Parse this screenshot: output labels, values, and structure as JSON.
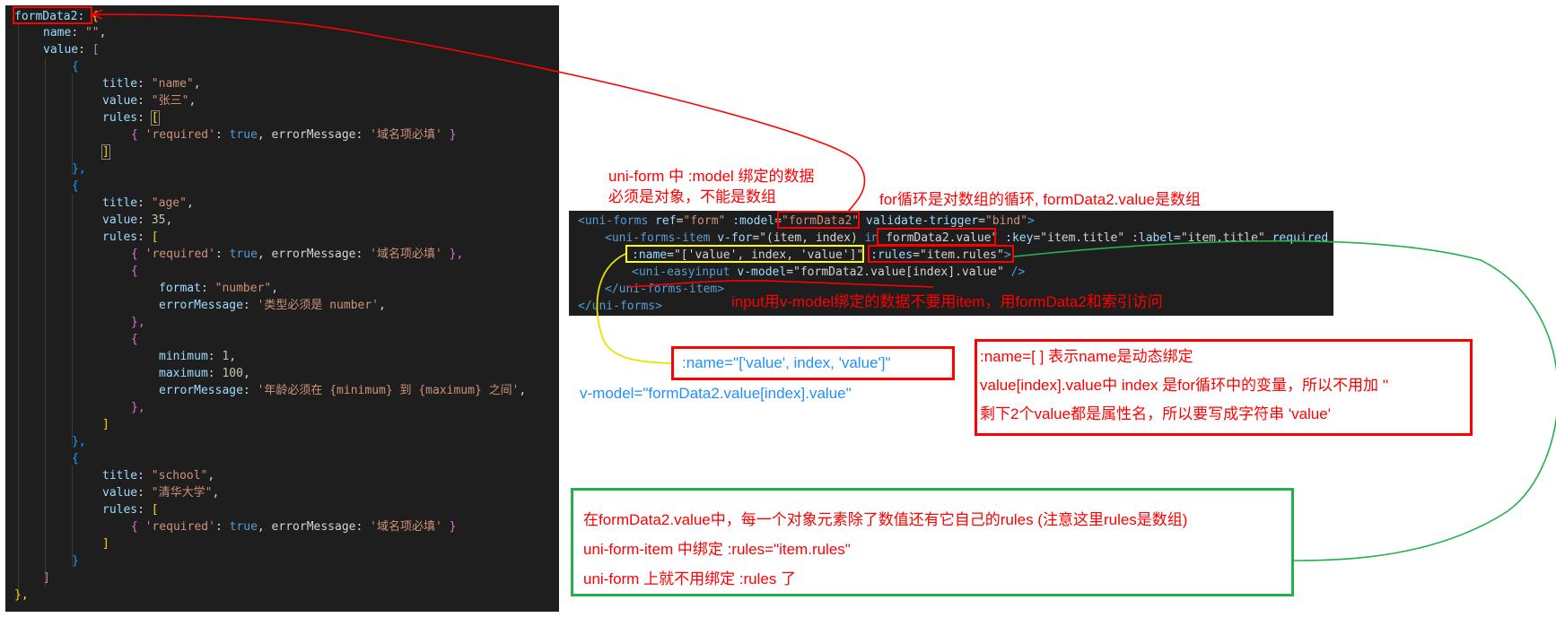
{
  "left_code": {
    "l1": "formData2:",
    "l1b": " {",
    "l2a": "name",
    "l2b": ": ",
    "l2c": "\"\"",
    "l2d": ",",
    "l3a": "value",
    "l3b": ": ",
    "l3c": "[",
    "l4": "{",
    "l5a": "title",
    "l5b": ": ",
    "l5c": "\"name\"",
    "l5d": ",",
    "l6a": "value",
    "l6b": ": ",
    "l6c": "\"张三\"",
    "l6d": ",",
    "l7a": "rules",
    "l7b": ": ",
    "l7c": "[",
    "l8a": "{ ",
    "l8b": "'required'",
    "l8c": ": ",
    "l8d": "true",
    "l8e": ", errorMessage: ",
    "l8f": "'域名项必填'",
    "l8g": " }",
    "l9": "]",
    "l10": "},",
    "l11": "{",
    "l12a": "title",
    "l12b": ": ",
    "l12c": "\"age\"",
    "l12d": ",",
    "l13a": "value",
    "l13b": ": ",
    "l13c": "35",
    "l13d": ",",
    "l14a": "rules",
    "l14b": ": ",
    "l14c": "[",
    "l15a": "{ ",
    "l15b": "'required'",
    "l15c": ": ",
    "l15d": "true",
    "l15e": ", errorMessage: ",
    "l15f": "'域名项必填'",
    "l15g": " },",
    "l16": "{",
    "l17a": "format",
    "l17b": ": ",
    "l17c": "\"number\"",
    "l17d": ",",
    "l18a": "errorMessage",
    "l18b": ": ",
    "l18c": "'类型必须是 number'",
    "l18d": ",",
    "l19": "},",
    "l20": "{",
    "l21a": "minimum",
    "l21b": ": ",
    "l21c": "1",
    "l21d": ",",
    "l22a": "maximum",
    "l22b": ": ",
    "l22c": "100",
    "l22d": ",",
    "l23a": "errorMessage",
    "l23b": ": ",
    "l23c": "'年龄必须在 {minimum} 到 {maximum} 之间'",
    "l23d": ",",
    "l24": "},",
    "l25": "]",
    "l26": "},",
    "l27": "{",
    "l28a": "title",
    "l28b": ": ",
    "l28c": "\"school\"",
    "l28d": ",",
    "l29a": "value",
    "l29b": ": ",
    "l29c": "\"清华大学\"",
    "l29d": ",",
    "l30a": "rules",
    "l30b": ": ",
    "l30c": "[",
    "l31a": "{ ",
    "l31b": "'required'",
    "l31c": ": ",
    "l31d": "true",
    "l31e": ", errorMessage: ",
    "l31f": "'域名项必填'",
    "l31g": " }",
    "l32": "]",
    "l33": "}",
    "l34": "]",
    "l35": "},"
  },
  "right_code": {
    "r1a": "<uni-forms ",
    "r1b": "ref",
    "r1c": "=",
    "r1d": "\"form\"",
    "r1e": " :model",
    "r1f": "=",
    "r1g": "\"formData2\"",
    "r1h": " validate-trigger",
    "r1i": "=",
    "r1j": "\"bind\"",
    "r1k": ">",
    "r2a": "<uni-forms-item ",
    "r2b": "v-for",
    "r2c": "=\"(item, index) ",
    "r2d": "in",
    "r2e": " formData2.value\"",
    "r2f": " :key",
    "r2g": "=\"item.title\"",
    "r2h": " :label",
    "r2i": "=\"item.title\"",
    "r2j": " required",
    "r3a": ":name",
    "r3b": "=\"['value', index, 'value']\"",
    "r3c": " :rules",
    "r3d": "=\"item.rules\"",
    "r3e": ">",
    "r4a": "<uni-easyinput ",
    "r4b": "v-model",
    "r4c": "=\"formData2.value[index].value\"",
    "r4d": " />",
    "r5": "</uni-forms-item>",
    "r6": "</uni-forms>"
  },
  "notes": {
    "model_note_1": "uni-form 中 :model 绑定的数据",
    "model_note_2": "必须是对象，不能是数组",
    "for_note": "for循环是对数组的循环, formData2.value是数组",
    "input_note": "input用v-model绑定的数据不要用item，用formData2和索引访问",
    "name_example": ":name=\"['value', index, 'value']\"",
    "vmodel_example": "v-model=\"formData2.value[index].value\"",
    "name_explain_1": ":name=[ ] 表示name是动态绑定",
    "name_explain_2": "value[index].value中 index 是for循环中的变量，所以不用加 ''",
    "name_explain_3": "剩下2个value都是属性名，所以要写成字符串 'value'",
    "rules_note_1": "在formData2.value中，每一个对象元素除了数值还有它自己的rules (注意这里rules是数组)",
    "rules_note_2": "uni-form-item 中绑定 :rules=\"item.rules\"",
    "rules_note_3": "uni-form 上就不用绑定 :rules 了"
  },
  "colors": {
    "editor_bg": "#1e1e1e",
    "annotation_red": "#ff0000",
    "annotation_green": "#22b14c",
    "annotation_yellow": "#ffff00",
    "annotation_blue": "#1e90ff"
  }
}
